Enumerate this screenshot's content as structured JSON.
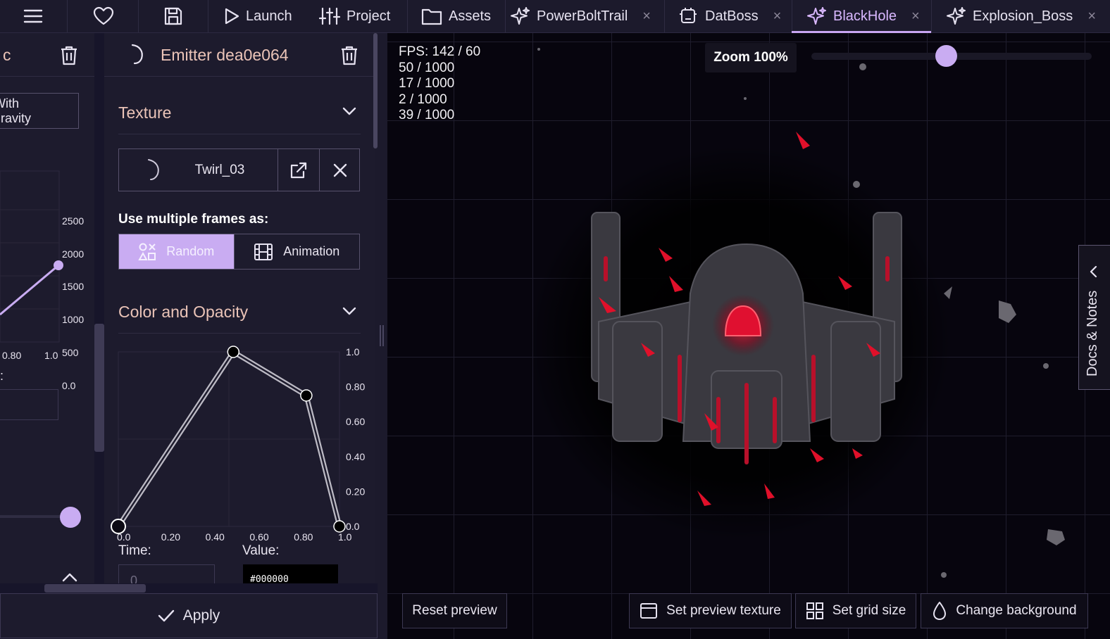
{
  "topbar": {
    "launch": "Launch",
    "project": "Project",
    "assets": "Assets",
    "tabs": [
      {
        "label": "PowerBoltTrail",
        "icon": "sparkle-icon"
      },
      {
        "label": "DatBoss",
        "icon": "robot-icon"
      },
      {
        "label": "BlackHole",
        "icon": "sparkle-icon",
        "active": true
      },
      {
        "label": "Explosion_Boss",
        "icon": "sparkle-icon"
      }
    ],
    "close_glyph": "×"
  },
  "left_emitter": {
    "title_fragment": "c",
    "gravity_button": "With gravity",
    "chart_y_ticks": [
      "2500",
      "2000",
      "1500",
      "1000",
      "500",
      "0.0"
    ],
    "chart_x_ticks": [
      "0.80",
      "1.0"
    ],
    "colon": ":"
  },
  "emitter": {
    "title": "Emitter dea0e064",
    "texture": {
      "section": "Texture",
      "name": "Twirl_03"
    },
    "frames": {
      "label": "Use multiple frames as:",
      "random": "Random",
      "animation": "Animation",
      "selected": "Random"
    },
    "color_opacity": {
      "section": "Color and Opacity",
      "y_ticks": [
        "1.0",
        "0.80",
        "0.60",
        "0.40",
        "0.20",
        "0.0"
      ],
      "x_ticks": [
        "0.0",
        "0.20",
        "0.40",
        "0.60",
        "0.80",
        "1.0"
      ],
      "points": [
        {
          "time": 0.0,
          "value": 0.0
        },
        {
          "time": 0.52,
          "value": 1.0
        },
        {
          "time": 0.85,
          "value": 0.75
        },
        {
          "time": 1.0,
          "value": 0.0
        }
      ],
      "time_label": "Time:",
      "value_label": "Value:",
      "time_value": "0",
      "color_value": "#000000"
    },
    "apply": "Apply"
  },
  "preview": {
    "stats": [
      "FPS: 142 / 60",
      "50 / 1000",
      "17 / 1000",
      "2 / 1000",
      "39 / 1000"
    ],
    "zoom_label": "Zoom 100%",
    "zoom_level": 0.48,
    "buttons": {
      "reset": "Reset preview",
      "texture": "Set preview texture",
      "grid": "Set grid size",
      "background": "Change background"
    },
    "docs_tab": "Docs & Notes"
  }
}
